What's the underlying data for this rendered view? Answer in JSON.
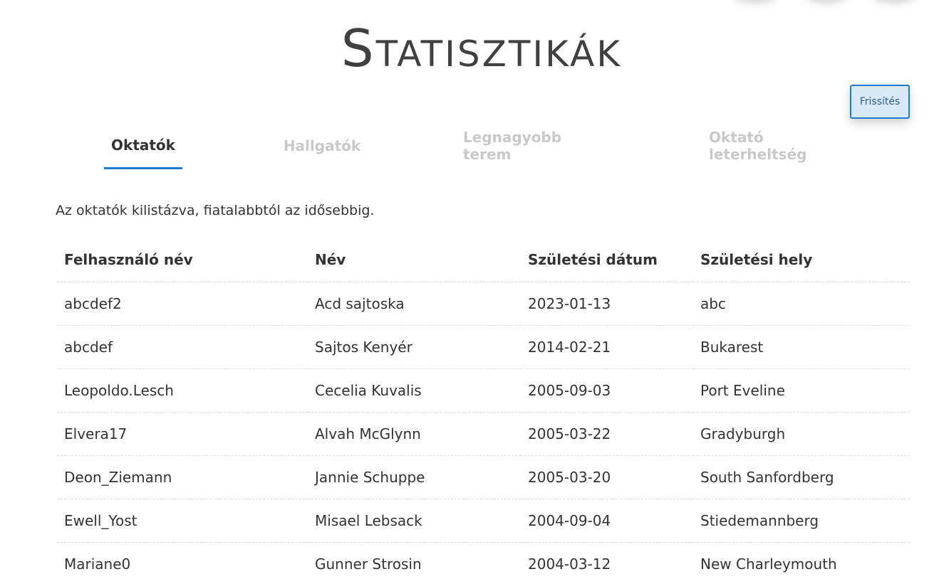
{
  "header": {
    "title": "Statisztikák",
    "refresh_label": "Frissítés"
  },
  "tabs": [
    {
      "label": "Oktatók",
      "active": true
    },
    {
      "label": "Hallgatók",
      "active": false
    },
    {
      "label": "Legnagyobb terem",
      "active": false
    },
    {
      "label": "Oktató leterheltség",
      "active": false
    }
  ],
  "content": {
    "description": "Az oktatók kilistázva, fiatalabbtól az idősebbig.",
    "columns": [
      "Felhasználó név",
      "Név",
      "Születési dátum",
      "Születési hely"
    ],
    "rows": [
      [
        "abcdef2",
        "Acd sajtoska",
        "2023-01-13",
        "abc"
      ],
      [
        "abcdef",
        "Sajtos Kenyér",
        "2014-02-21",
        "Bukarest"
      ],
      [
        "Leopoldo.Lesch",
        "Cecelia Kuvalis",
        "2005-09-03",
        "Port Eveline"
      ],
      [
        "Elvera17",
        "Alvah McGlynn",
        "2005-03-22",
        "Gradyburgh"
      ],
      [
        "Deon_Ziemann",
        "Jannie Schuppe",
        "2005-03-20",
        "South Sanfordberg"
      ],
      [
        "Ewell_Yost",
        "Misael Lebsack",
        "2004-09-04",
        "Stiedemannberg"
      ],
      [
        "Mariane0",
        "Gunner Strosin",
        "2004-03-12",
        "New Charleymouth"
      ]
    ]
  },
  "colors": {
    "accent": "#1f7ad6",
    "button_bg": "#d9e9f8",
    "inactive_tab": "#c9c9c9",
    "text": "#333333"
  }
}
